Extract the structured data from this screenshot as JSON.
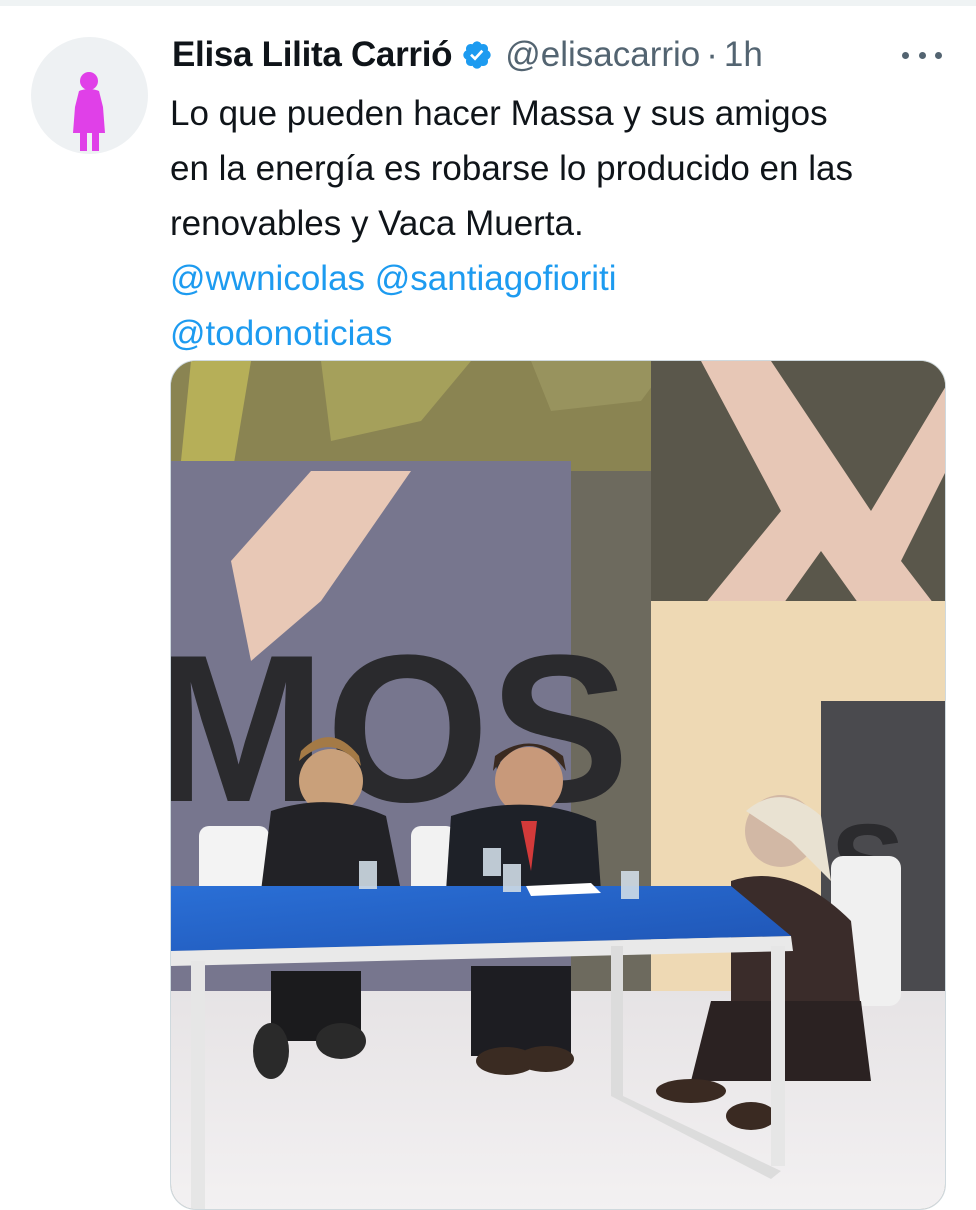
{
  "tweet": {
    "author_name": "Elisa Lilita Carrió",
    "handle": "@elisacarrio",
    "separator": "·",
    "time": "1h",
    "text_lines": [
      "Lo que pueden hacer Massa y sus amigos",
      "en la energía es robarse lo producido en las",
      "renovables y Vaca Muerta."
    ],
    "mentions": [
      "@wwnicolas",
      "@santiagofioriti",
      "@todonoticias"
    ],
    "icons": {
      "avatar": "pink-person-silhouette",
      "verified": "verified-badge-icon",
      "more": "more-options-icon"
    },
    "colors": {
      "link": "#1d9bf0",
      "secondary_text": "#536471",
      "verified": "#1d9bf0",
      "avatar_figure": "#e040e8"
    }
  },
  "media": {
    "backdrop_text": "MOS",
    "type": "photo-tv-studio"
  }
}
